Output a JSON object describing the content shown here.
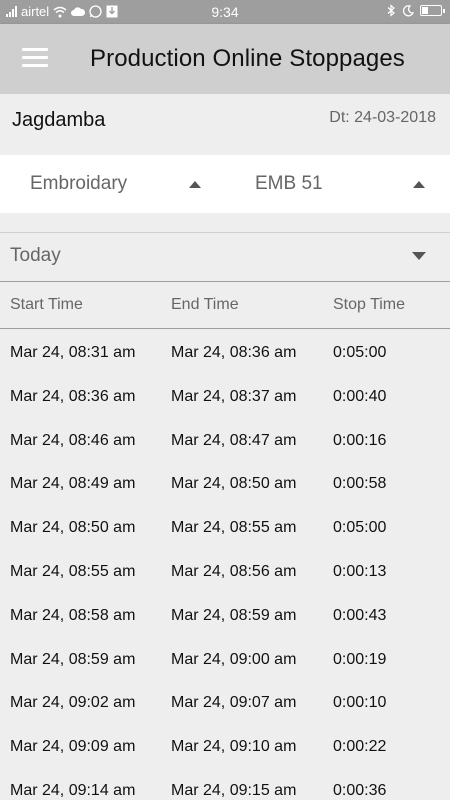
{
  "status_bar": {
    "carrier": "airtel",
    "time": "9:34",
    "icons": [
      "signal-icon",
      "wifi-icon",
      "cloud-icon",
      "whatsapp-icon",
      "download-icon",
      "bluetooth-icon",
      "do-not-disturb-icon",
      "battery-icon"
    ],
    "battery_level": 0.35
  },
  "app_bar": {
    "title": "Production Online Stoppages",
    "menu_icon": "hamburger-menu-icon"
  },
  "info": {
    "unit": "Jagdamba",
    "date": "Dt: 24-03-2018"
  },
  "selectors": {
    "department": "Embroidary",
    "machine": "EMB 51"
  },
  "period": {
    "selected": "Today"
  },
  "table": {
    "headers": [
      "Start Time",
      "End Time",
      "Stop Time"
    ],
    "rows": [
      [
        "Mar 24, 08:31 am",
        "Mar 24, 08:36 am",
        "0:05:00"
      ],
      [
        "Mar 24, 08:36 am",
        "Mar 24, 08:37 am",
        "0:00:40"
      ],
      [
        "Mar 24, 08:46 am",
        "Mar 24, 08:47 am",
        "0:00:16"
      ],
      [
        "Mar 24, 08:49 am",
        "Mar 24, 08:50 am",
        "0:00:58"
      ],
      [
        "Mar 24, 08:50 am",
        "Mar 24, 08:55 am",
        "0:05:00"
      ],
      [
        "Mar 24, 08:55 am",
        "Mar 24, 08:56 am",
        "0:00:13"
      ],
      [
        "Mar 24, 08:58 am",
        "Mar 24, 08:59 am",
        "0:00:43"
      ],
      [
        "Mar 24, 08:59 am",
        "Mar 24, 09:00 am",
        "0:00:19"
      ],
      [
        "Mar 24, 09:02 am",
        "Mar 24, 09:07 am",
        "0:00:10"
      ],
      [
        "Mar 24, 09:09 am",
        "Mar 24, 09:10 am",
        "0:00:22"
      ],
      [
        "Mar 24, 09:14 am",
        "Mar 24, 09:15 am",
        "0:00:36"
      ]
    ]
  },
  "colors": {
    "status_bar": "#9e9e9e",
    "app_bar": "#cfcfcf",
    "background": "#eeeeee"
  }
}
